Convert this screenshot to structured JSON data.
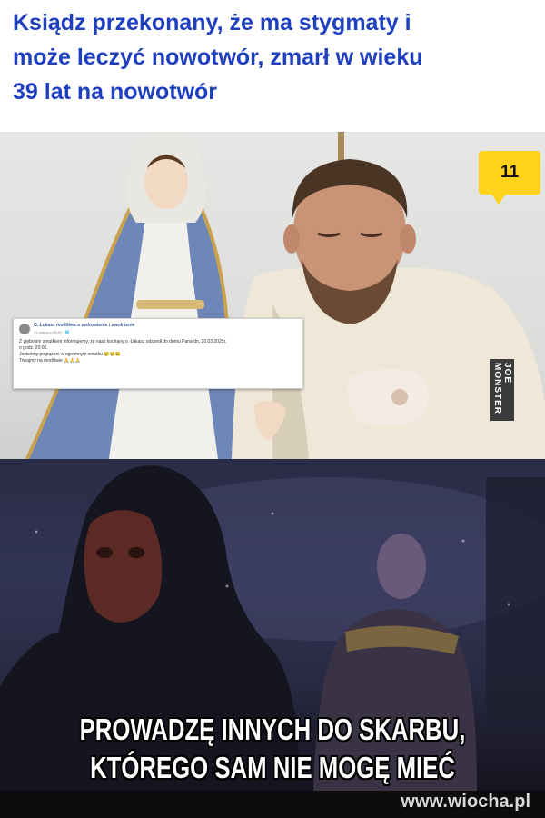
{
  "headline": {
    "text": "Ksiądz przekonany, że ma stygmaty i\nmoże leczyć nowotwór, zmarł w wieku\n39 lat na nowotwór",
    "color": "#1e3fbf"
  },
  "photo": {
    "badge_count": "11",
    "badge_color": "#ffd21c",
    "side_watermark": "JOE MONSTER"
  },
  "facebook_post": {
    "page_name": "O. Łukasz modlitwa o uzdrowienie i uwolnienie",
    "date": "21 marca o 08:51 · 🌐",
    "lines": [
      "Z głębokim smutkiem informujemy, że nasz kochany o. Łukasz odszedł do domu Pana dn. 20.03.2025r.",
      "o godz. 20:00.",
      "Jesteśmy pogrążeni w ogromnym smutku 😢😢😢",
      "Trwajmy na modlitwie 🙏🙏🙏"
    ]
  },
  "meme": {
    "caption": "PROWADZĘ INNYCH DO SKARBU,\nKTÓREGO SAM NIE MOGĘ MIEĆ"
  },
  "footer": {
    "watermark": "www.wiocha.pl"
  }
}
